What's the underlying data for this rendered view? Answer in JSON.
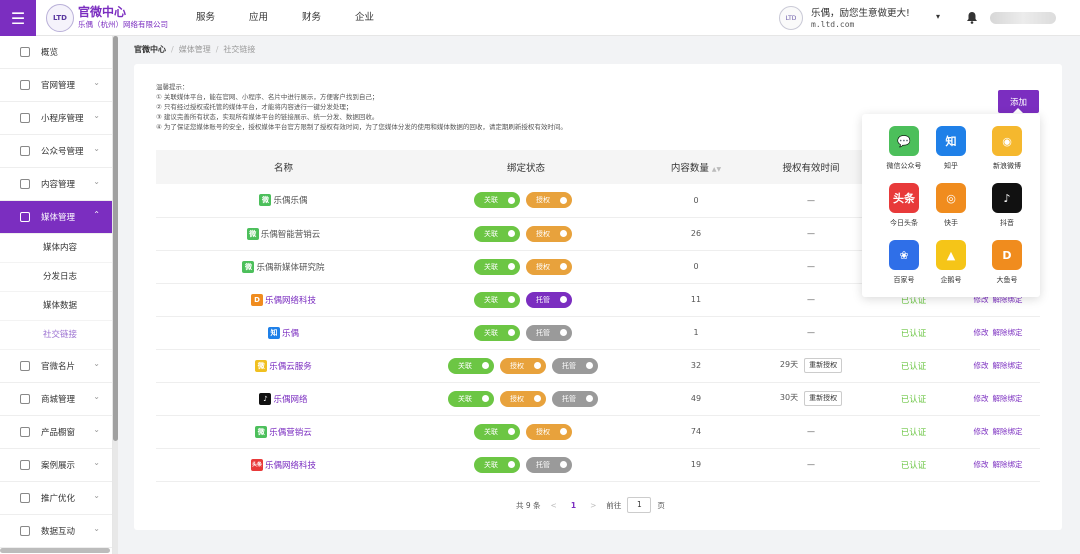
{
  "header": {
    "menu_icon": "hamburger-icon",
    "logo_text": "LTD",
    "brand_title": "官微中心",
    "brand_subtitle": "乐偶（杭州）网络有限公司",
    "nav": [
      "服务",
      "应用",
      "财务",
      "企业"
    ],
    "greeting": "乐偶，励您生意做更大!",
    "domain": "m.ltd.com",
    "caret": "▾",
    "accent": "#7b2ec0"
  },
  "sidebar": {
    "items": [
      {
        "label": "概览",
        "icon": "dashboard-icon",
        "arrow": ""
      },
      {
        "label": "官网管理",
        "icon": "website-icon",
        "arrow": "⌄"
      },
      {
        "label": "小程序管理",
        "icon": "miniapp-icon",
        "arrow": "⌄"
      },
      {
        "label": "公众号管理",
        "icon": "official-account-icon",
        "arrow": "⌄"
      },
      {
        "label": "内容管理",
        "icon": "content-icon",
        "arrow": "⌄"
      },
      {
        "label": "媒体管理",
        "icon": "media-icon",
        "arrow": "⌃",
        "active": true
      }
    ],
    "sub_items": [
      "媒体内容",
      "分发日志",
      "媒体数据",
      "社交链接"
    ],
    "items_after": [
      {
        "label": "官微名片",
        "icon": "card-icon",
        "arrow": "⌄"
      },
      {
        "label": "商城管理",
        "icon": "shop-icon",
        "arrow": "⌄"
      },
      {
        "label": "产品橱窗",
        "icon": "product-icon",
        "arrow": "⌄"
      },
      {
        "label": "案例展示",
        "icon": "case-icon",
        "arrow": "⌄"
      },
      {
        "label": "推广优化",
        "icon": "promotion-icon",
        "arrow": "⌄"
      },
      {
        "label": "数据互动",
        "icon": "data-icon",
        "arrow": "⌄"
      }
    ]
  },
  "breadcrumb": [
    "官微中心",
    "媒体管理",
    "社交链接"
  ],
  "tips": {
    "title": "温馨提示：",
    "lines": [
      "① 关联媒体平台，能在官网、小程序、名片中进行展示，方便客户找到自己；",
      "② 只有经过授权或托管的媒体平台，才能将内容进行一键分发处理；",
      "③ 建议完善所有状态，实现所有媒体平台的链接展示、统一分发、数据回收。",
      "④ 为了保证您媒体账号的安全，授权媒体平台官方限制了授权有效时间，为了您媒体分发的使用和媒体数据的回收，请定期刷新授权有效时间。"
    ]
  },
  "add_button": "添加",
  "table": {
    "headers": [
      "名称",
      "绑定状态",
      "内容数量",
      "授权有效时间",
      "",
      ""
    ],
    "sort_icon": "▲▼",
    "rows": [
      {
        "icon": "wechat-icon",
        "icon_color": "#4cbf5b",
        "icon_glyph": "微",
        "name": "乐偶乐偶",
        "highlight": false,
        "badges": [
          {
            "t": "关联",
            "c": "green"
          },
          {
            "t": "授权",
            "c": "orange"
          }
        ],
        "count": "0",
        "time": "—",
        "status": "已认证",
        "ops": [
          "修改",
          "解除绑定"
        ]
      },
      {
        "icon": "wechat-icon",
        "icon_color": "#4cbf5b",
        "icon_glyph": "微",
        "name": "乐偶智能营销云",
        "highlight": false,
        "badges": [
          {
            "t": "关联",
            "c": "green"
          },
          {
            "t": "授权",
            "c": "orange"
          }
        ],
        "count": "26",
        "time": "—",
        "status": "已认证",
        "ops": [
          "修改",
          "解除绑定"
        ]
      },
      {
        "icon": "wechat-icon",
        "icon_color": "#4cbf5b",
        "icon_glyph": "微",
        "name": "乐偶新媒体研究院",
        "highlight": false,
        "badges": [
          {
            "t": "关联",
            "c": "green"
          },
          {
            "t": "授权",
            "c": "orange"
          }
        ],
        "count": "0",
        "time": "—",
        "status": "已认证",
        "ops": [
          "修改",
          "解除绑定"
        ]
      },
      {
        "icon": "dayu-icon",
        "icon_color": "#f08c1e",
        "icon_glyph": "D",
        "name": "乐偶网络科技",
        "highlight": true,
        "badges": [
          {
            "t": "关联",
            "c": "green"
          },
          {
            "t": "托管",
            "c": "purple"
          }
        ],
        "count": "11",
        "time": "—",
        "status": "已认证",
        "ops": [
          "修改",
          "解除绑定"
        ]
      },
      {
        "icon": "zhihu-icon",
        "icon_color": "#1f80e8",
        "icon_glyph": "知",
        "name": "乐偶",
        "highlight": true,
        "badges": [
          {
            "t": "关联",
            "c": "green"
          },
          {
            "t": "托管",
            "c": "gray"
          }
        ],
        "count": "1",
        "time": "—",
        "status": "已认证",
        "ops": [
          "修改",
          "解除绑定"
        ]
      },
      {
        "icon": "weibo-icon",
        "icon_color": "#f0c020",
        "icon_glyph": "微",
        "name": "乐偶云服务",
        "highlight": true,
        "badges": [
          {
            "t": "关联",
            "c": "green"
          },
          {
            "t": "授权",
            "c": "orange"
          },
          {
            "t": "托管",
            "c": "gray"
          }
        ],
        "count": "32",
        "time": "29天",
        "reauth": "重新授权",
        "status": "已认证",
        "ops": [
          "修改",
          "解除绑定"
        ]
      },
      {
        "icon": "douyin-icon",
        "icon_color": "#111111",
        "icon_glyph": "♪",
        "name": "乐偶网络",
        "highlight": true,
        "badges": [
          {
            "t": "关联",
            "c": "green"
          },
          {
            "t": "授权",
            "c": "orange"
          },
          {
            "t": "托管",
            "c": "gray"
          }
        ],
        "count": "49",
        "time": "30天",
        "reauth": "重新授权",
        "status": "已认证",
        "ops": [
          "修改",
          "解除绑定"
        ]
      },
      {
        "icon": "wechat-icon",
        "icon_color": "#4cbf5b",
        "icon_glyph": "微",
        "name": "乐偶营销云",
        "highlight": true,
        "badges": [
          {
            "t": "关联",
            "c": "green"
          },
          {
            "t": "授权",
            "c": "orange"
          }
        ],
        "count": "74",
        "time": "—",
        "status": "已认证",
        "ops": [
          "修改",
          "解除绑定"
        ]
      },
      {
        "icon": "toutiao-icon",
        "icon_color": "#e83a3a",
        "icon_glyph": "头条",
        "name": "乐偶网络科技",
        "highlight": true,
        "badges": [
          {
            "t": "关联",
            "c": "green"
          },
          {
            "t": "托管",
            "c": "gray"
          }
        ],
        "count": "19",
        "time": "—",
        "status": "已认证",
        "ops": [
          "修改",
          "解除绑定"
        ]
      }
    ]
  },
  "pagination": {
    "total": "共 9 条",
    "prev": "<",
    "current": "1",
    "next": ">",
    "goto_label": "前往",
    "goto_value": "1",
    "page_suffix": "页"
  },
  "popover": {
    "items": [
      {
        "label": "微信公众号",
        "icon": "wechat-icon",
        "color": "#4cbf5b",
        "glyph": "💬"
      },
      {
        "label": "知乎",
        "icon": "zhihu-icon",
        "color": "#1f80e8",
        "glyph": "知"
      },
      {
        "label": "新浪微博",
        "icon": "weibo-icon",
        "color": "#f5b82e",
        "glyph": "◉"
      },
      {
        "label": "今日头条",
        "icon": "toutiao-icon",
        "color": "#e83a3a",
        "glyph": "头条"
      },
      {
        "label": "快手",
        "icon": "kuaishou-icon",
        "color": "#f08c1e",
        "glyph": "◎"
      },
      {
        "label": "抖音",
        "icon": "douyin-icon",
        "color": "#111111",
        "glyph": "♪"
      },
      {
        "label": "百家号",
        "icon": "baijiahao-icon",
        "color": "#2f6fe8",
        "glyph": "❀"
      },
      {
        "label": "企鹅号",
        "icon": "qiehao-icon",
        "color": "#f5c518",
        "glyph": "▲"
      },
      {
        "label": "大鱼号",
        "icon": "dayu-icon",
        "color": "#f08c1e",
        "glyph": "D"
      }
    ]
  }
}
